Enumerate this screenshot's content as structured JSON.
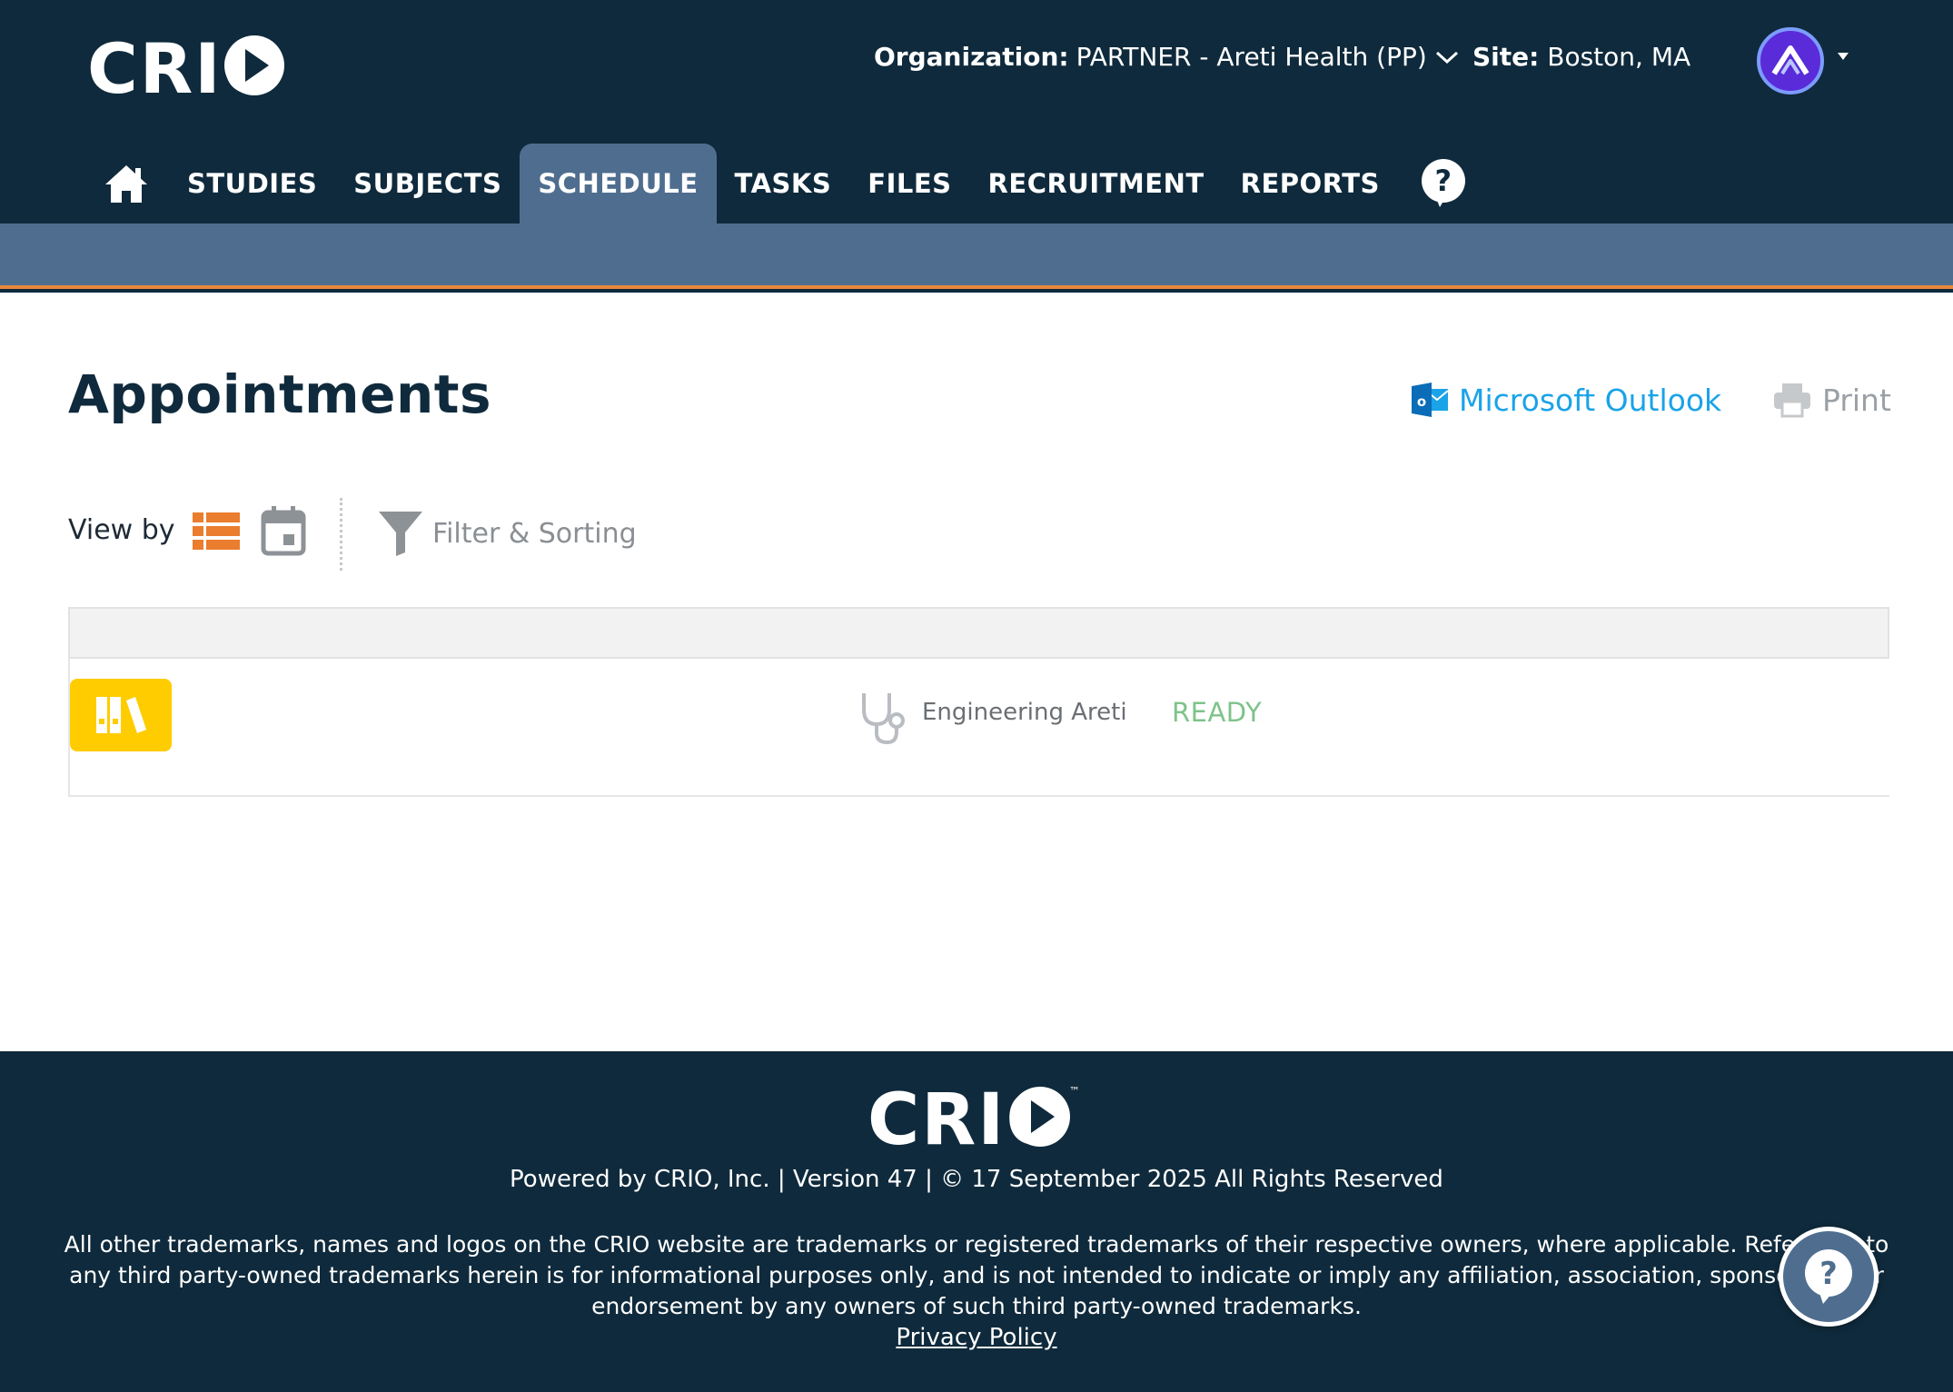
{
  "header": {
    "logo_text": "CRIO",
    "org_label": "Organization:",
    "org_value": "PARTNER - Areti Health (PP)",
    "site_label": "Site:",
    "site_value": "Boston, MA"
  },
  "nav": {
    "items": [
      {
        "label": "STUDIES"
      },
      {
        "label": "SUBJECTS"
      },
      {
        "label": "SCHEDULE",
        "active": true
      },
      {
        "label": "TASKS"
      },
      {
        "label": "FILES"
      },
      {
        "label": "RECRUITMENT"
      },
      {
        "label": "REPORTS"
      }
    ]
  },
  "main": {
    "title": "Appointments",
    "outlook_label": "Microsoft Outlook",
    "print_label": "Print",
    "view_by_label": "View by",
    "filter_label": "Filter & Sorting",
    "appointment": {
      "provider": "Engineering Areti",
      "status": "READY"
    }
  },
  "footer": {
    "logo_text": "CRIO",
    "powered_by": "Powered by CRIO, Inc. | Version 47 | © 17 September 2025 All Rights Reserved",
    "trademark": "All other trademarks, names and logos on the CRIO website are trademarks or registered trademarks of their respective owners, where applicable. Reference to any third party-owned trademarks herein is for informational purposes only, and is not intended to indicate or imply any affiliation, association, sponsorship, or endorsement by any owners of such third party-owned trademarks.",
    "privacy": "Privacy Policy"
  },
  "colors": {
    "header_bg": "#0f2a3c",
    "nav_active": "#4f6e8f",
    "accent_orange": "#e8883a",
    "outlook_blue": "#1aa3e8",
    "status_green": "#7ec38a",
    "study_yellow": "#ffcc00"
  },
  "icons": [
    "home-icon",
    "help-icon",
    "chevron-down-icon",
    "avatar-icon",
    "outlook-icon",
    "print-icon",
    "list-view-icon",
    "calendar-icon",
    "filter-icon",
    "study-binder-icon",
    "stethoscope-icon"
  ]
}
